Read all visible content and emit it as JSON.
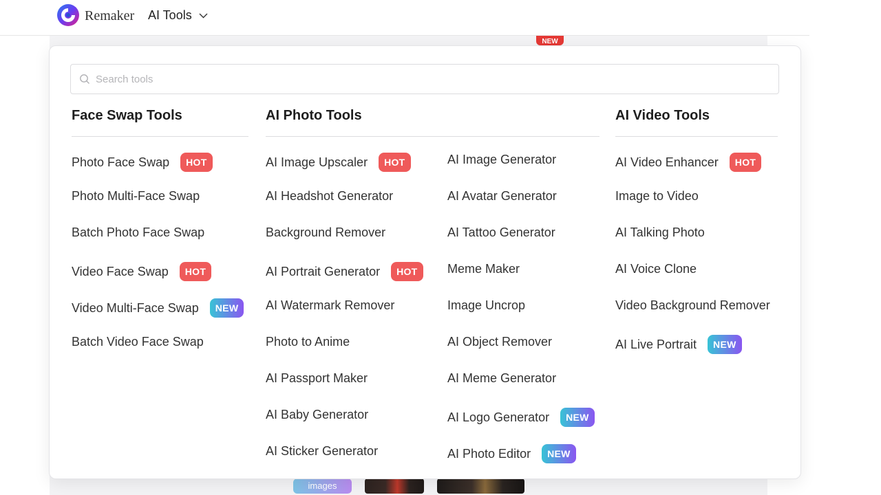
{
  "header": {
    "brand": "Remaker",
    "menu_label": "AI Tools"
  },
  "background": {
    "new_badge": "NEW",
    "images_button": "images"
  },
  "search": {
    "placeholder": "Search tools"
  },
  "columns": {
    "face_swap": {
      "title": "Face Swap Tools",
      "items": [
        {
          "label": "Photo Face Swap",
          "badge": "HOT"
        },
        {
          "label": "Photo Multi-Face Swap",
          "badge": ""
        },
        {
          "label": "Batch Photo Face Swap",
          "badge": ""
        },
        {
          "label": "Video Face Swap",
          "badge": "HOT"
        },
        {
          "label": "Video Multi-Face Swap",
          "badge": "NEW"
        },
        {
          "label": "Batch Video Face Swap",
          "badge": ""
        }
      ]
    },
    "photo": {
      "title": "AI Photo Tools",
      "items_left": [
        {
          "label": "AI Image Upscaler",
          "badge": "HOT"
        },
        {
          "label": "AI Headshot Generator",
          "badge": ""
        },
        {
          "label": "Background Remover",
          "badge": ""
        },
        {
          "label": "AI Portrait Generator",
          "badge": "HOT"
        },
        {
          "label": "AI Watermark Remover",
          "badge": ""
        },
        {
          "label": "Photo to Anime",
          "badge": ""
        },
        {
          "label": "AI Passport Maker",
          "badge": ""
        },
        {
          "label": "AI Baby Generator",
          "badge": ""
        },
        {
          "label": "AI Sticker Generator",
          "badge": ""
        }
      ],
      "items_right": [
        {
          "label": "AI Image Generator",
          "badge": ""
        },
        {
          "label": "AI Avatar Generator",
          "badge": ""
        },
        {
          "label": "AI Tattoo Generator",
          "badge": ""
        },
        {
          "label": "Meme Maker",
          "badge": ""
        },
        {
          "label": "Image Uncrop",
          "badge": ""
        },
        {
          "label": "AI Object Remover",
          "badge": ""
        },
        {
          "label": "AI Meme Generator",
          "badge": ""
        },
        {
          "label": "AI Logo Generator",
          "badge": "NEW"
        },
        {
          "label": "AI Photo Editor",
          "badge": "NEW"
        }
      ]
    },
    "video": {
      "title": "AI Video Tools",
      "items": [
        {
          "label": "AI Video Enhancer",
          "badge": "HOT"
        },
        {
          "label": "Image to Video",
          "badge": ""
        },
        {
          "label": "AI Talking Photo",
          "badge": ""
        },
        {
          "label": "AI Voice Clone",
          "badge": ""
        },
        {
          "label": "Video Background Remover",
          "badge": ""
        },
        {
          "label": "AI Live Portrait",
          "badge": "NEW"
        }
      ]
    }
  },
  "colors": {
    "hot": "#ef5a5a",
    "new_start": "#38c3d6",
    "new_end": "#8a56f0"
  }
}
